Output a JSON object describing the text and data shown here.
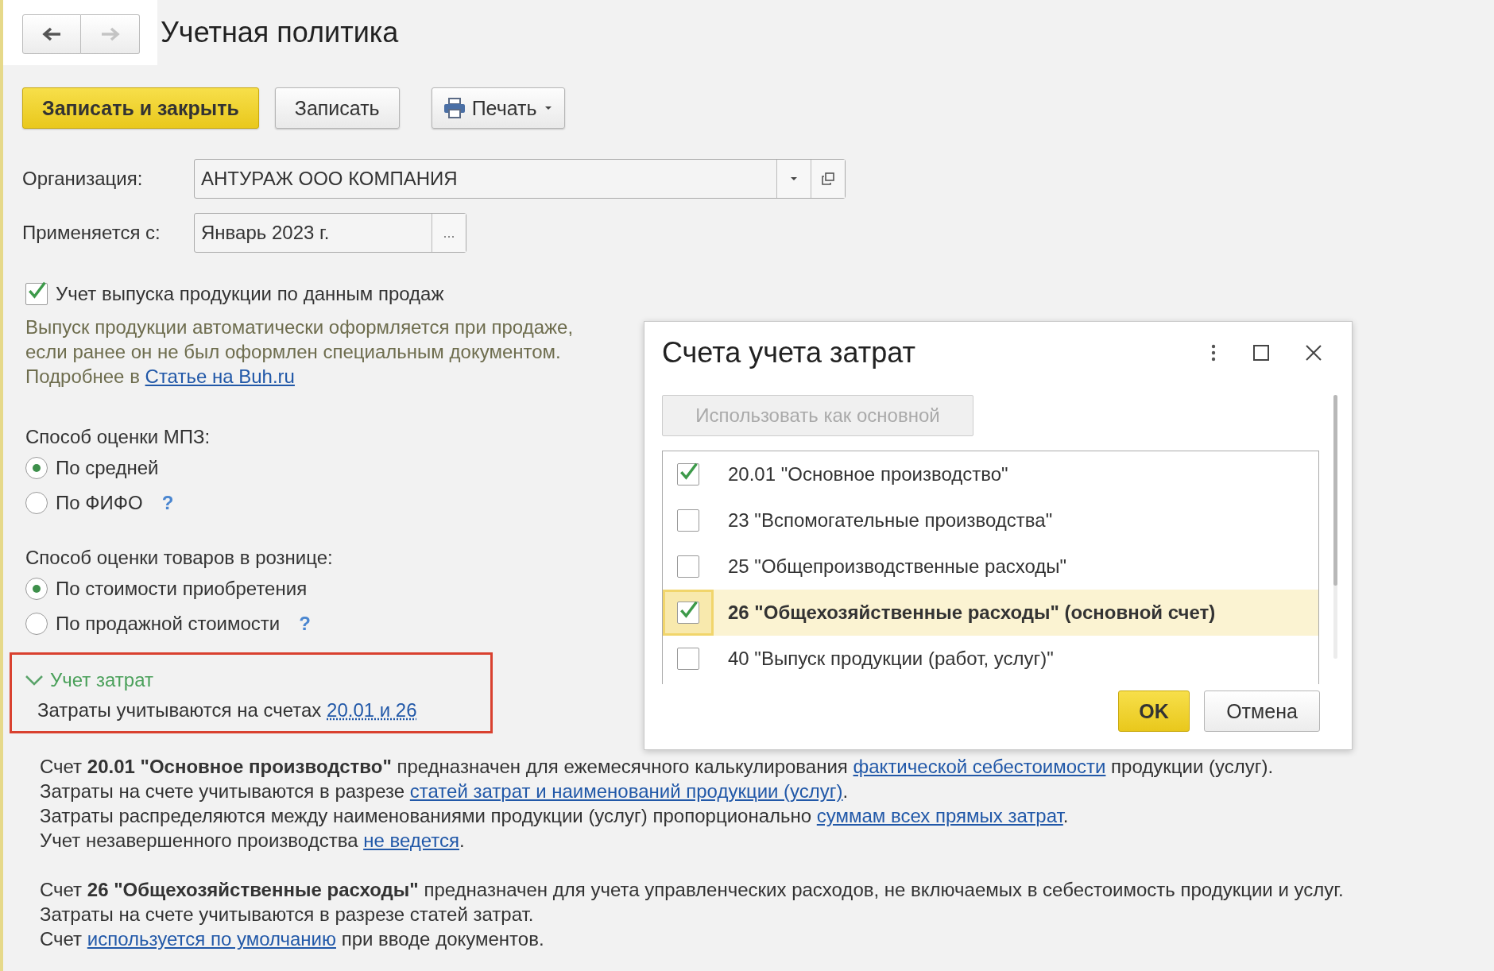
{
  "nav": [
    {
      "kind": "back",
      "disabled": false
    },
    {
      "kind": "forward",
      "disabled": true
    }
  ],
  "title": "Учетная политика",
  "toolbar": [
    {
      "label": "Записать и закрыть",
      "kind": "primary"
    },
    {
      "label": "Записать",
      "kind": "plain"
    },
    {
      "label": "Печать",
      "kind": "print"
    }
  ],
  "fields": [
    {
      "label": "Организация:",
      "value": "АНТУРАЖ ООО КОМПАНИЯ",
      "kind": "select"
    },
    {
      "label": "Применяется с:",
      "value": "Январь 2023 г.",
      "kind": "picker",
      "button_text": "..."
    }
  ],
  "output_check": {
    "label": "Учет выпуска продукции по данным продаж",
    "checked": true
  },
  "output_note": {
    "lines": [
      "Выпуск продукции автоматически оформляется при продаже,",
      "если ранее он не был оформлен специальным документом."
    ],
    "more_prefix": "Подробнее в",
    "more_link": "Статье на Buh.ru"
  },
  "radio_groups": [
    {
      "label": "Способ оценки МПЗ:",
      "options": [
        {
          "label": "По средней",
          "selected": true
        },
        {
          "label": "По ФИФО",
          "selected": false,
          "help": "?"
        }
      ]
    },
    {
      "label": "Способ оценки товаров в рознице:",
      "options": [
        {
          "label": "По стоимости приобретения",
          "selected": true
        },
        {
          "label": "По продажной стоимости",
          "selected": false,
          "help": "?"
        }
      ]
    }
  ],
  "cost_section": {
    "title": "Учет затрат",
    "expanded": true,
    "text": "Затраты учитываются на счетах",
    "link": "20.01 и 26"
  },
  "details": [
    [
      [
        {
          "kind": "plain",
          "text": "Счет "
        },
        {
          "kind": "bold",
          "text": "20.01 \"Основное производство\""
        },
        {
          "kind": "plain",
          "text": " предназначен для ежемесячного калькулирования "
        },
        {
          "kind": "link",
          "text": "фактической себестоимости"
        },
        {
          "kind": "plain",
          "text": " продукции (услуг)."
        }
      ],
      [
        {
          "kind": "plain",
          "text": "Затраты на счете учитываются в разрезе "
        },
        {
          "kind": "link",
          "text": "статей затрат и наименований продукции (услуг)"
        },
        {
          "kind": "plain",
          "text": "."
        }
      ],
      [
        {
          "kind": "plain",
          "text": "Затраты распределяются между наименованиями продукции (услуг) пропорционально "
        },
        {
          "kind": "link",
          "text": "суммам всех прямых затрат"
        },
        {
          "kind": "plain",
          "text": "."
        }
      ],
      [
        {
          "kind": "plain",
          "text": "Учет незавершенного производства "
        },
        {
          "kind": "link",
          "text": "не ведется"
        },
        {
          "kind": "plain",
          "text": "."
        }
      ]
    ],
    [
      [
        {
          "kind": "plain",
          "text": "Счет "
        },
        {
          "kind": "bold",
          "text": "26 \"Общехозяйственные расходы\""
        },
        {
          "kind": "plain",
          "text": " предназначен для учета управленческих расходов, не включаемых в себестоимость продукции и услуг."
        }
      ],
      [
        {
          "kind": "plain",
          "text": "Затраты на счете учитываются в разрезе статей затрат."
        }
      ],
      [
        {
          "kind": "plain",
          "text": "Счет "
        },
        {
          "kind": "link",
          "text": "используется по умолчанию"
        },
        {
          "kind": "plain",
          "text": " при вводе документов."
        }
      ]
    ]
  ],
  "dialog": {
    "title": "Счета учета затрат",
    "set_main_button": {
      "label": "Использовать как основной",
      "disabled": true
    },
    "accounts": [
      {
        "label": "20.01 \"Основное производство\"",
        "checked": true,
        "selected": false,
        "main": false
      },
      {
        "label": "23 \"Вспомогательные производства\"",
        "checked": false,
        "selected": false,
        "main": false
      },
      {
        "label": "25 \"Общепроизводственные расходы\"",
        "checked": false,
        "selected": false,
        "main": false
      },
      {
        "label": "26 \"Общехозяйственные расходы\" (основной счет)",
        "checked": true,
        "selected": true,
        "main": true
      },
      {
        "label": "40 \"Выпуск продукции (работ, услуг)\"",
        "checked": false,
        "selected": false,
        "main": false
      }
    ],
    "ok": "OK",
    "cancel": "Отмена"
  }
}
